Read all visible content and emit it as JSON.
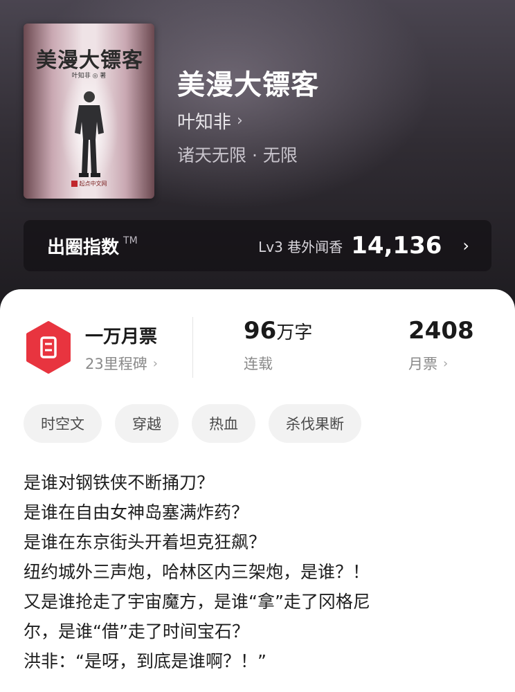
{
  "book": {
    "title": "美漫大镖客",
    "author": "叶知非",
    "genre": "诸天无限 · 无限",
    "cover": {
      "title": "美漫大镖客",
      "author": "叶知非 ◎ 著",
      "publisher": "起点中文网"
    }
  },
  "index_bar": {
    "label": "出圈指数",
    "tm": "TM",
    "level": "Lv3 巷外闻香",
    "value": "14,136"
  },
  "stats": {
    "ticket": {
      "main": "一万月票",
      "sub": "23里程碑"
    },
    "words": {
      "num": "96",
      "unit": "万字",
      "sub": "连载"
    },
    "monthly": {
      "num": "2408",
      "sub": "月票"
    }
  },
  "tags": [
    "时空文",
    "穿越",
    "热血",
    "杀伐果断"
  ],
  "synopsis": [
    "是谁对钢铁侠不断捅刀？",
    "是谁在自由女神岛塞满炸药？",
    "是谁在东京街头开着坦克狂飙？",
    "纽约城外三声炮，哈林区内三架炮，是谁？！",
    "又是谁抢走了宇宙魔方，是谁“拿”走了冈格尼",
    "尔，是谁“借”走了时间宝石？",
    "洪非：“是呀，到底是谁啊？！”"
  ],
  "colors": {
    "accent": "#e8343f",
    "hero_dark": "#1c1a1e"
  }
}
